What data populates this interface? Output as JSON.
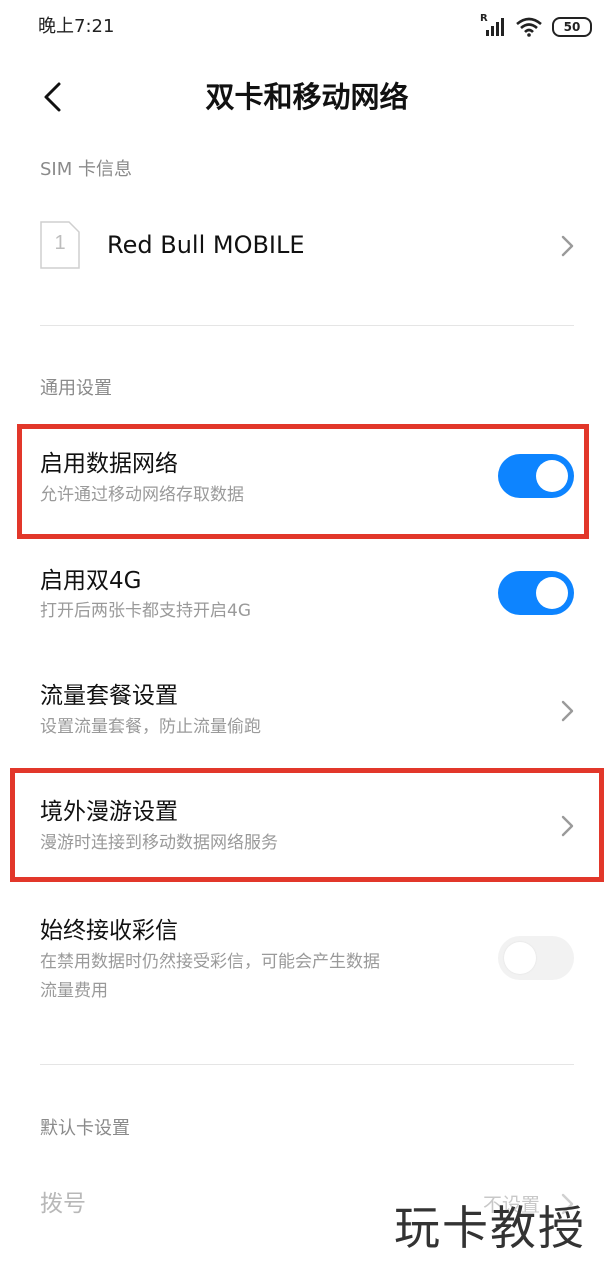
{
  "status_bar": {
    "time": "晚上7:21",
    "signal_label": "R",
    "battery": "50",
    "icons": [
      "signal-icon",
      "wifi-icon",
      "battery-icon"
    ]
  },
  "header": {
    "title": "双卡和移动网络",
    "back_icon": "back-arrow-icon"
  },
  "sim_section": {
    "label": "SIM 卡信息",
    "card": {
      "slot_number": "1",
      "carrier": "Red Bull MOBILE"
    }
  },
  "general_section": {
    "label": "通用设置",
    "items": [
      {
        "title": "启用数据网络",
        "subtitle": "允许通过移动网络存取数据",
        "type": "toggle",
        "enabled": true
      },
      {
        "title": "启用双4G",
        "subtitle": "打开后两张卡都支持开启4G",
        "type": "toggle",
        "enabled": true
      },
      {
        "title": "流量套餐设置",
        "subtitle": "设置流量套餐，防止流量偷跑",
        "type": "link"
      },
      {
        "title": "境外漫游设置",
        "subtitle": "漫游时连接到移动数据网络服务",
        "type": "link"
      },
      {
        "title": "始终接收彩信",
        "subtitle_line1": "在禁用数据时仍然接受彩信，可能会产生数据",
        "subtitle_line2": "流量费用",
        "type": "toggle",
        "enabled": false
      }
    ]
  },
  "default_section": {
    "label": "默认卡设置",
    "dial": {
      "title": "拨号",
      "value": "不设置"
    }
  },
  "watermark": "玩卡教授",
  "colors": {
    "accent": "#0d84ff",
    "highlight": "#e2372a",
    "section_label": "#8a8a8a",
    "subtitle": "#9a9a9a"
  }
}
